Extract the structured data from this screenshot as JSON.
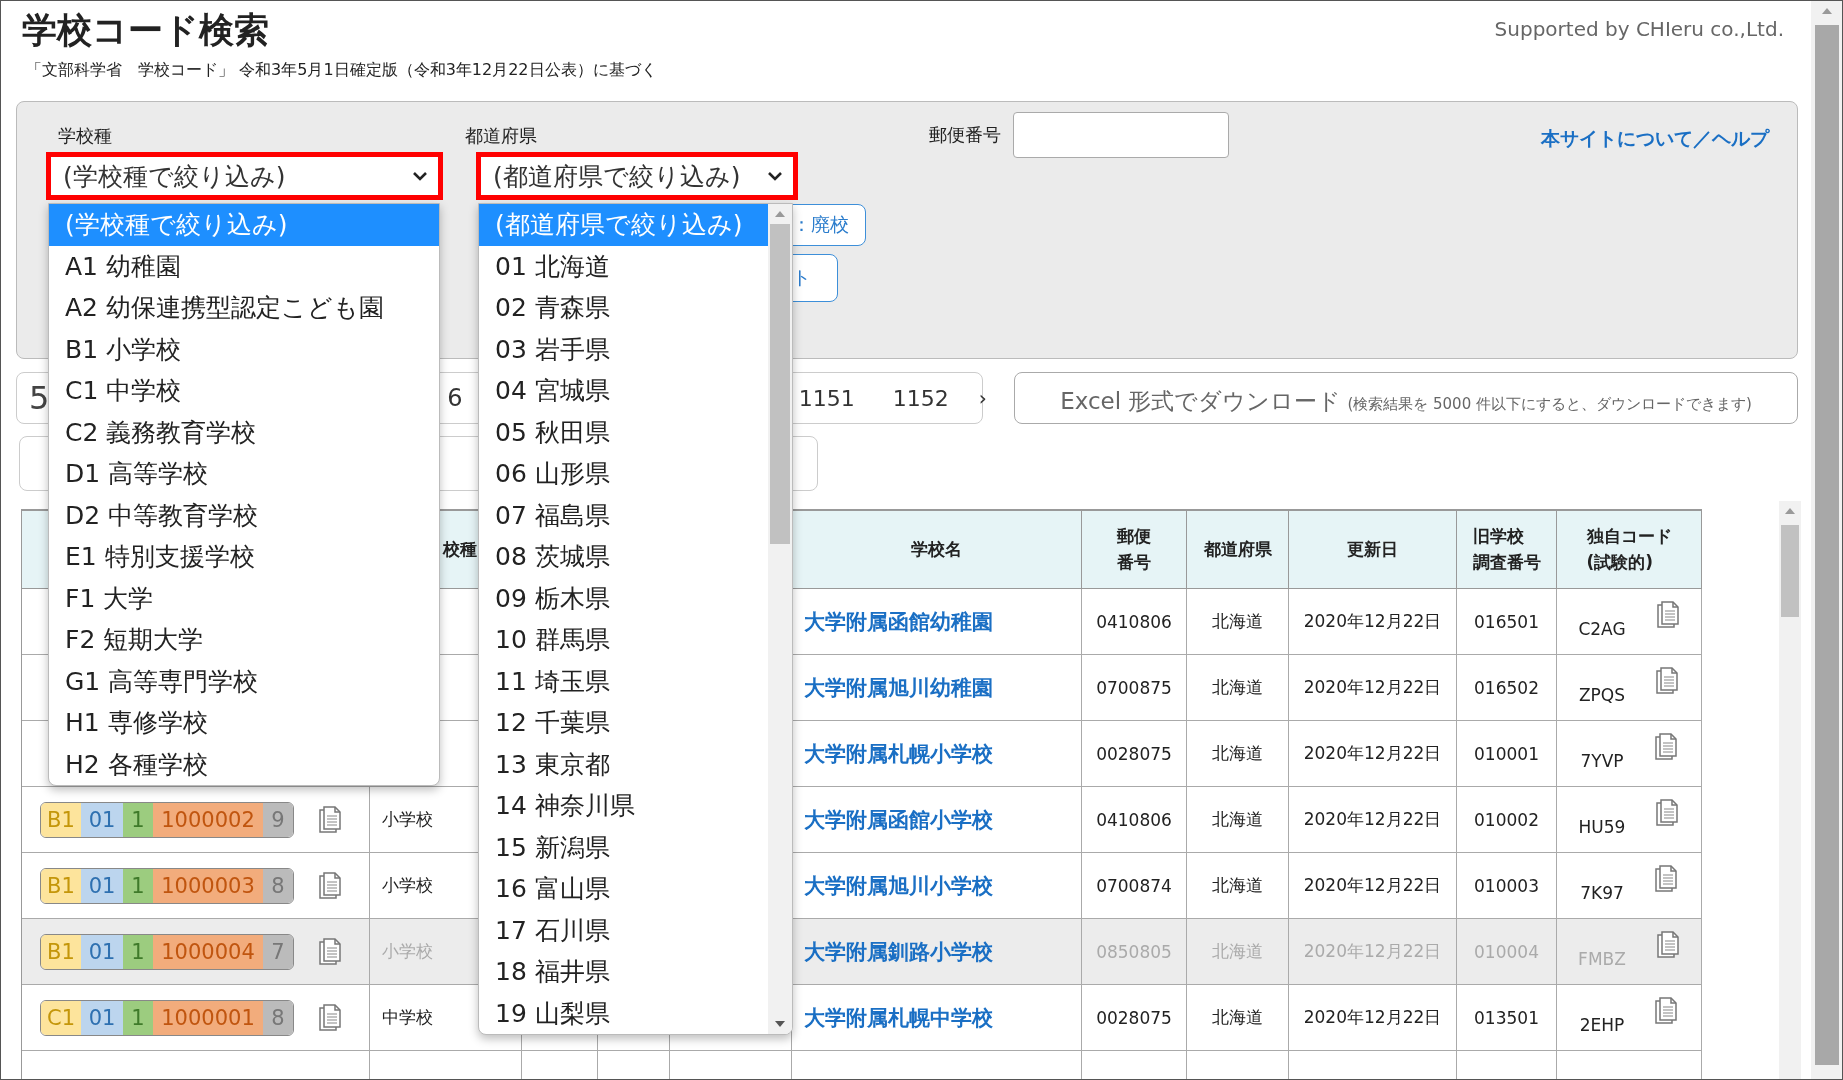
{
  "header": {
    "title": "学校コード検索",
    "subtitle": "「文部科学省　学校コード」 令和3年5月1日確定版（令和3年12月22日公表）に基づく",
    "credit": "Supported by CHIeru co.,Ltd."
  },
  "filters": {
    "school_type": {
      "label": "学校種",
      "value": "(学校種で絞り込み)"
    },
    "prefecture": {
      "label": "都道府県",
      "value": "(都道府県で絞り込み)"
    },
    "postal_label": "郵便番号",
    "help_link": "本サイトについて／ヘルプ",
    "buttons": [
      "：廃校",
      "ト"
    ]
  },
  "school_type_options": [
    {
      "label": "(学校種で絞り込み)",
      "selected": true
    },
    {
      "label": "A1 幼稚園",
      "selected": false
    },
    {
      "label": "A2 幼保連携型認定こども園",
      "selected": false
    },
    {
      "label": "B1 小学校",
      "selected": false
    },
    {
      "label": "C1 中学校",
      "selected": false
    },
    {
      "label": "C2 義務教育学校",
      "selected": false
    },
    {
      "label": "D1 高等学校",
      "selected": false
    },
    {
      "label": "D2 中等教育学校",
      "selected": false
    },
    {
      "label": "E1 特別支援学校",
      "selected": false
    },
    {
      "label": "F1 大学",
      "selected": false
    },
    {
      "label": "F2 短期大学",
      "selected": false
    },
    {
      "label": "G1 高等専門学校",
      "selected": false
    },
    {
      "label": "H1 専修学校",
      "selected": false
    },
    {
      "label": "H2 各種学校",
      "selected": false
    }
  ],
  "prefecture_options": [
    {
      "label": "(都道府県で絞り込み)",
      "selected": true
    },
    {
      "label": "01 北海道",
      "selected": false
    },
    {
      "label": "02 青森県",
      "selected": false
    },
    {
      "label": "03 岩手県",
      "selected": false
    },
    {
      "label": "04 宮城県",
      "selected": false
    },
    {
      "label": "05 秋田県",
      "selected": false
    },
    {
      "label": "06 山形県",
      "selected": false
    },
    {
      "label": "07 福島県",
      "selected": false
    },
    {
      "label": "08 茨城県",
      "selected": false
    },
    {
      "label": "09 栃木県",
      "selected": false
    },
    {
      "label": "10 群馬県",
      "selected": false
    },
    {
      "label": "11 埼玉県",
      "selected": false
    },
    {
      "label": "12 千葉県",
      "selected": false
    },
    {
      "label": "13 東京都",
      "selected": false
    },
    {
      "label": "14 神奈川県",
      "selected": false
    },
    {
      "label": "15 新潟県",
      "selected": false
    },
    {
      "label": "16 富山県",
      "selected": false
    },
    {
      "label": "17 石川県",
      "selected": false
    },
    {
      "label": "18 福井県",
      "selected": false
    },
    {
      "label": "19 山梨県",
      "selected": false
    }
  ],
  "pager": {
    "pages": [
      "5",
      "6",
      "1151",
      "1152"
    ],
    "next": "›"
  },
  "download": {
    "label": "Excel 形式でダウンロード",
    "note": "(検索結果を 5000 件以下にすると、ダウンロードできます)"
  },
  "table": {
    "columns": [
      {
        "lines": [
          "校種"
        ]
      },
      {
        "lines": [
          "学校名"
        ]
      },
      {
        "lines": [
          "郵便",
          "番号"
        ]
      },
      {
        "lines": [
          "都道府県"
        ]
      },
      {
        "lines": [
          "更新日"
        ]
      },
      {
        "lines": [
          "旧学校",
          "調査番号"
        ]
      },
      {
        "lines": [
          "独自コード",
          "(試験的)"
        ]
      }
    ],
    "rows": [
      {
        "name": "大学附属函館幼稚園",
        "postal": "0410806",
        "prefecture": "北海道",
        "updated": "2020年12月22日",
        "old_number": "016501",
        "own_code": "C2AG",
        "closed": false
      },
      {
        "name": "大学附属旭川幼稚園",
        "postal": "0700875",
        "prefecture": "北海道",
        "updated": "2020年12月22日",
        "old_number": "016502",
        "own_code": "ZPQS",
        "closed": false
      },
      {
        "name": "大学附属札幌小学校",
        "postal": "0028075",
        "prefecture": "北海道",
        "updated": "2020年12月22日",
        "old_number": "010001",
        "own_code": "7YVP",
        "closed": false
      },
      {
        "code": [
          "B1",
          "01",
          "1",
          "1000002",
          "9"
        ],
        "school_type": "小学校",
        "name": "大学附属函館小学校",
        "postal": "0410806",
        "prefecture": "北海道",
        "updated": "2020年12月22日",
        "old_number": "010002",
        "own_code": "HU59",
        "closed": false
      },
      {
        "code": [
          "B1",
          "01",
          "1",
          "1000003",
          "8"
        ],
        "school_type": "小学校",
        "name": "大学附属旭川小学校",
        "postal": "0700874",
        "prefecture": "北海道",
        "updated": "2020年12月22日",
        "old_number": "010003",
        "own_code": "7K97",
        "closed": false
      },
      {
        "code": [
          "B1",
          "01",
          "1",
          "1000004",
          "7"
        ],
        "school_type": "小学校",
        "name": "大学附属釧路小学校",
        "postal": "0850805",
        "prefecture": "北海道",
        "updated": "2020年12月22日",
        "old_number": "010004",
        "own_code": "FMBZ",
        "closed": true
      },
      {
        "code": [
          "C1",
          "01",
          "1",
          "1000001",
          "8"
        ],
        "school_type": "中学校",
        "name": "大学附属札幌中学校",
        "postal": "0028075",
        "prefecture": "北海道",
        "updated": "2020年12月22日",
        "old_number": "013501",
        "own_code": "2EHP",
        "closed": false
      }
    ]
  }
}
